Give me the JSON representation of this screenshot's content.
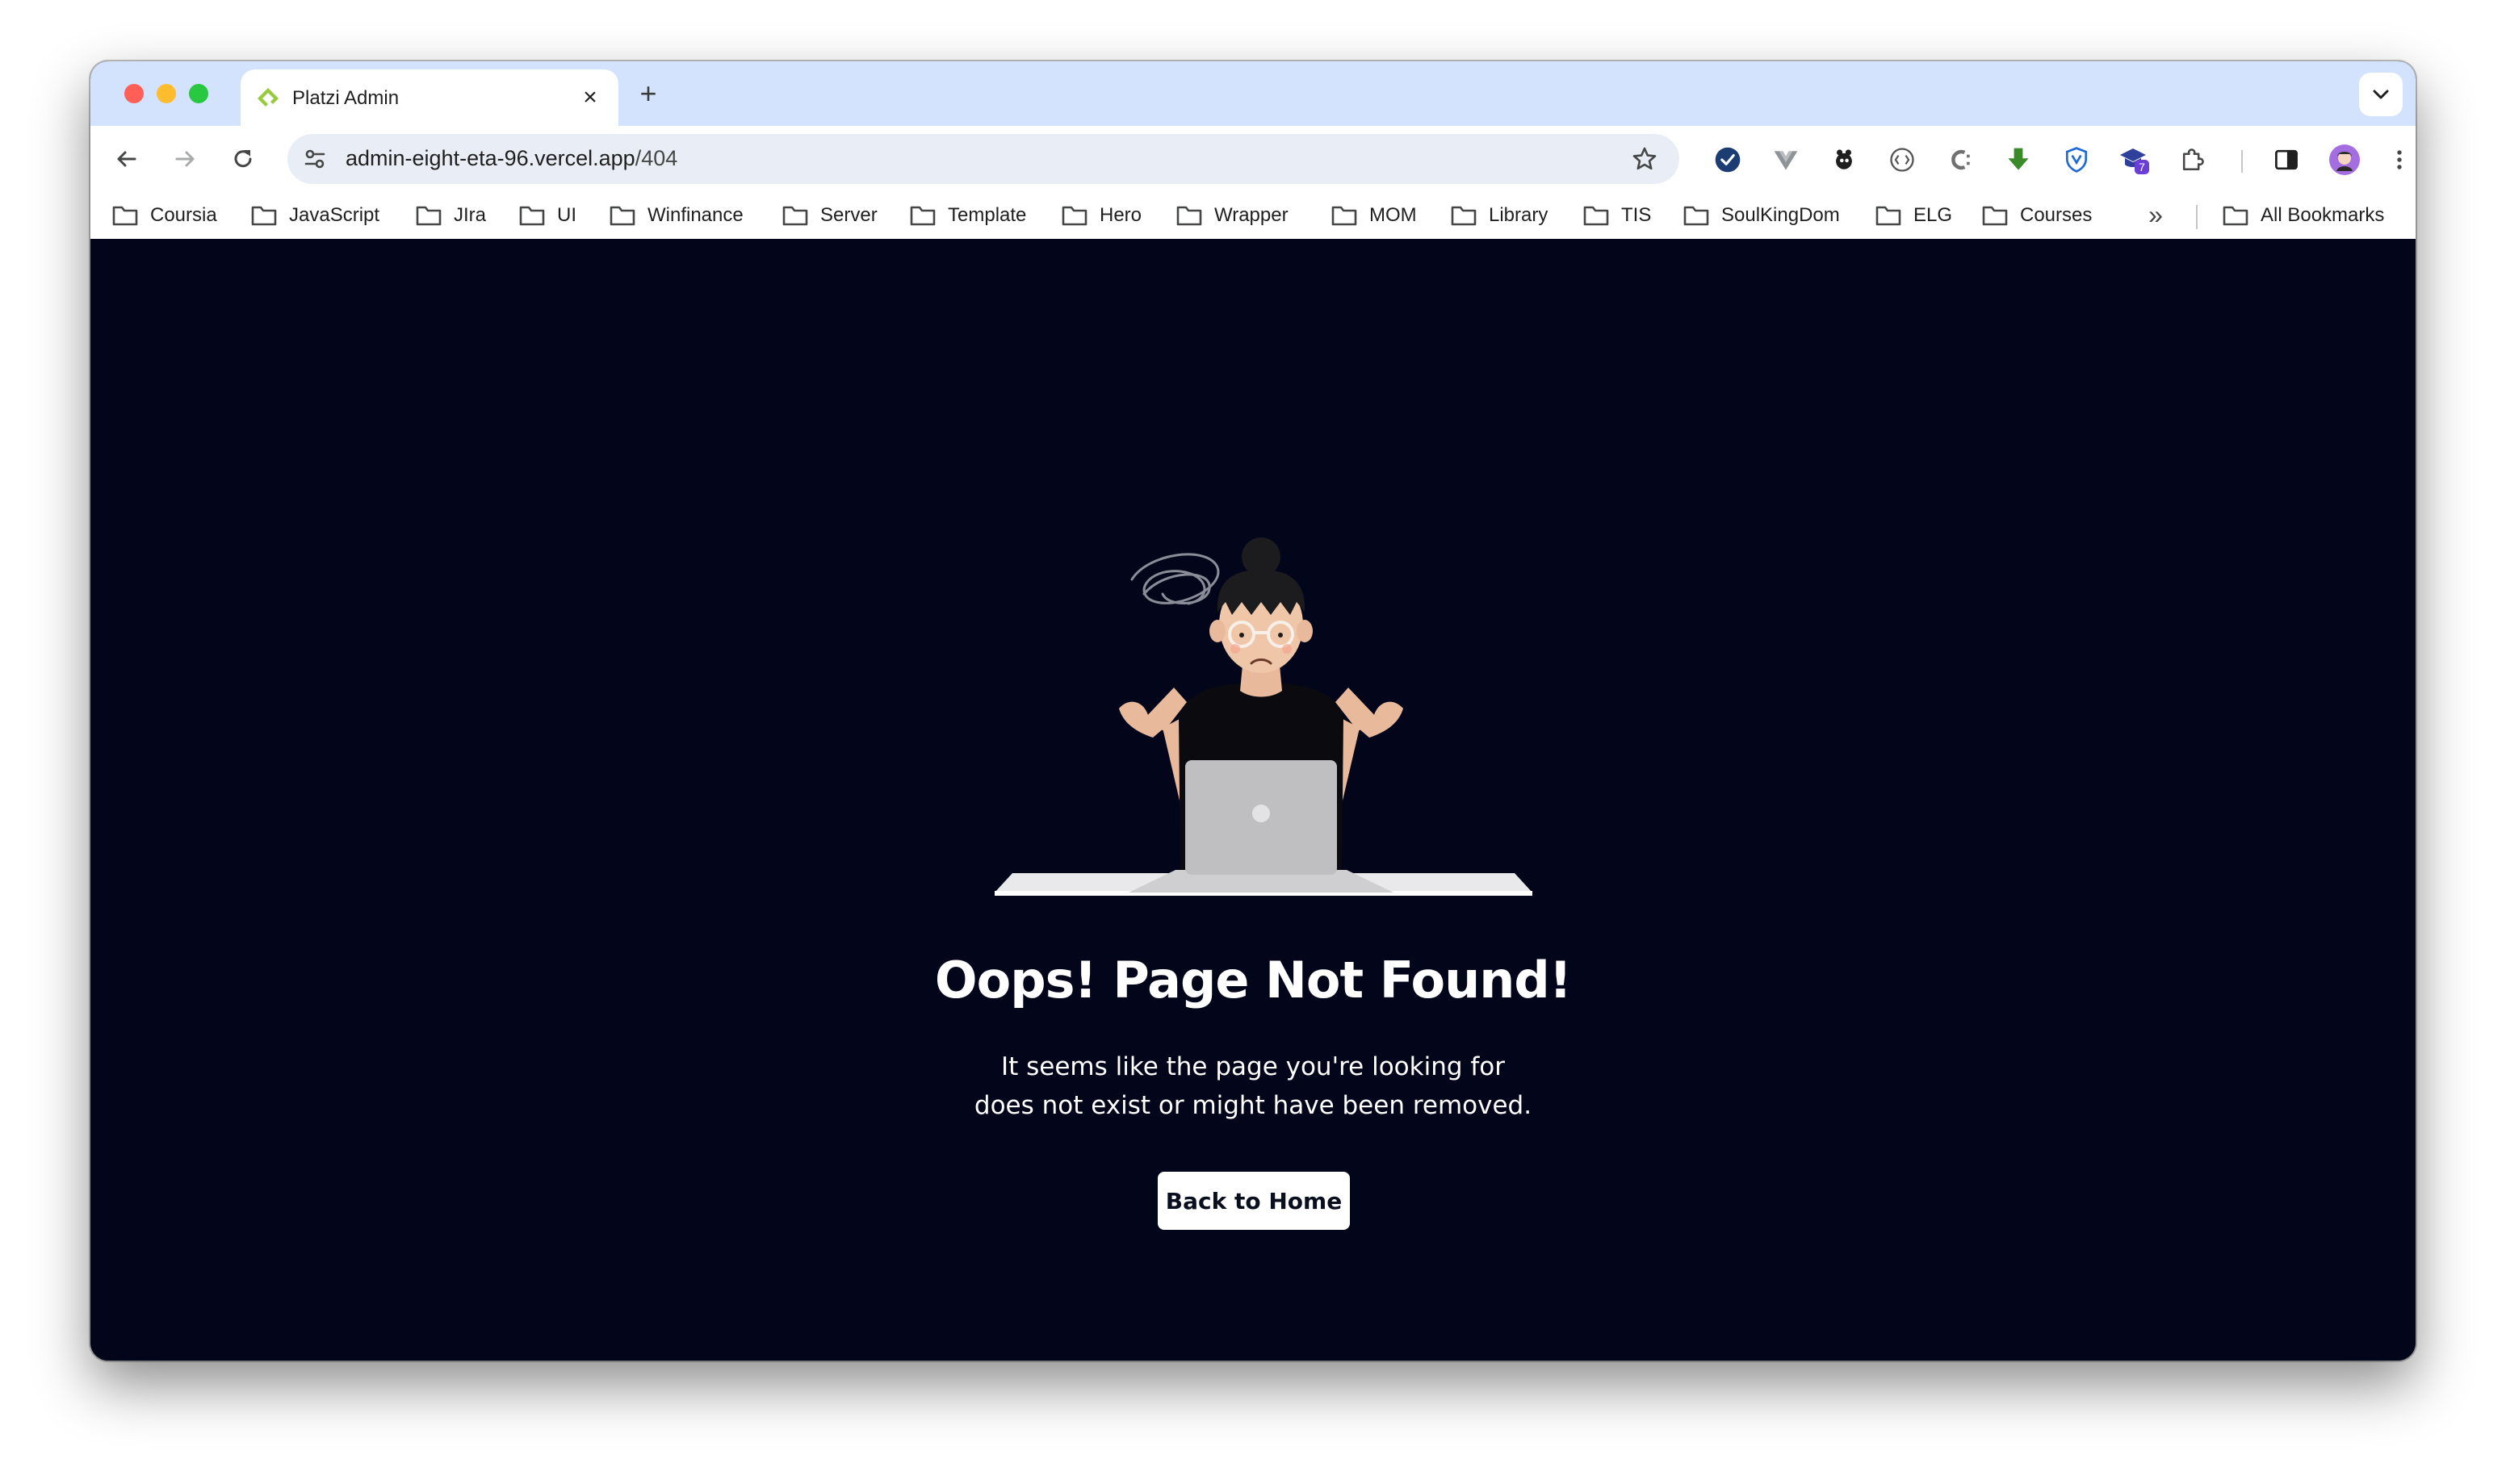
{
  "browser": {
    "tab": {
      "title": "Platzi Admin",
      "close_glyph": "×"
    },
    "new_tab_glyph": "+",
    "omnibox": {
      "host": "admin-eight-eta-96.vercel.app",
      "path": "/404"
    },
    "extension_badge_count": "7",
    "bookmarks": [
      "Coursia",
      "JavaScript",
      "JIra",
      "UI",
      "Winfinance",
      "Server",
      "Template",
      "Hero",
      "Wrapper",
      "MOM",
      "Library",
      "TIS",
      "SoulKingDom",
      "ELG",
      "Courses"
    ],
    "bookmarks_overflow_glyph": "»",
    "all_bookmarks": "All Bookmarks"
  },
  "page": {
    "title": "Oops! Page Not Found!",
    "description_line1": "It seems like the page you're looking for",
    "description_line2": "does not exist or might have been removed.",
    "home_button": "Back to Home"
  },
  "colors": {
    "page_background": "#03061a",
    "tab_strip": "#d3e3fd",
    "button_background": "#ffffff"
  }
}
